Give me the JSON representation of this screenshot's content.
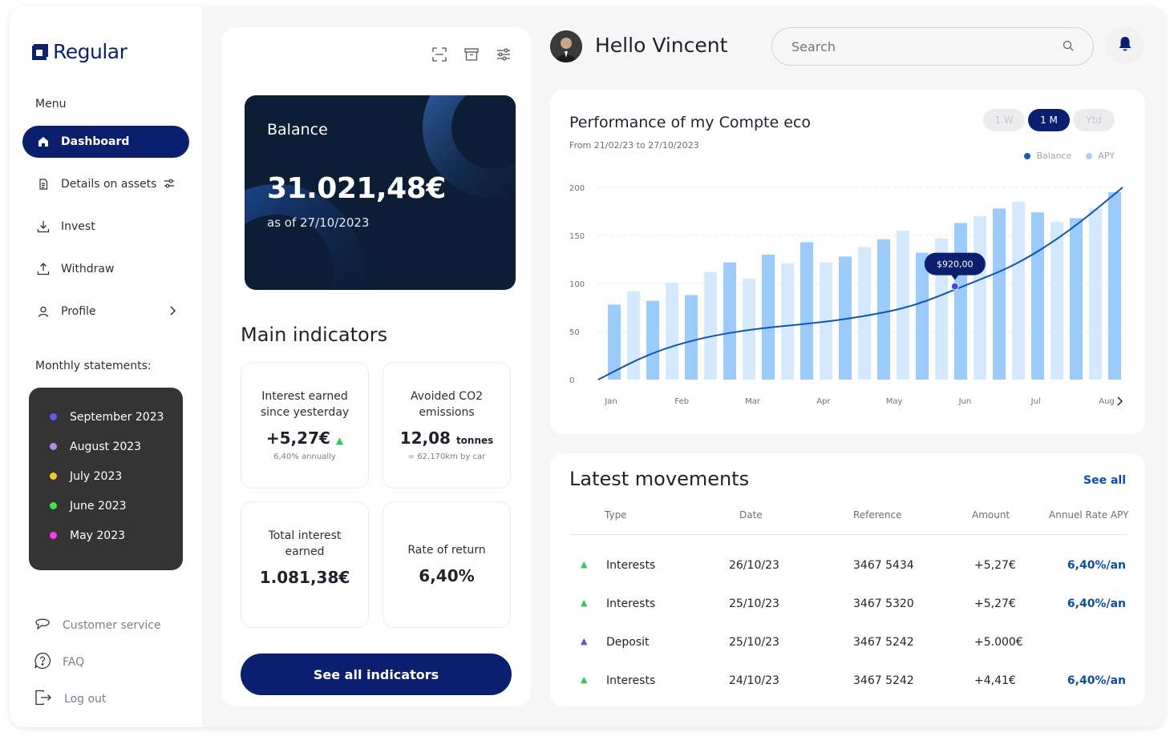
{
  "brand": {
    "name": "Regular",
    "color": "#0b2270"
  },
  "sidebar": {
    "menu_title": "Menu",
    "items": [
      {
        "label": "Dashboard",
        "icon": "home-icon",
        "active": true
      },
      {
        "label": "Details on assets",
        "icon": "document-icon",
        "trail_icon": "sliders-icon"
      },
      {
        "label": "Invest",
        "icon": "download-icon"
      },
      {
        "label": "Withdraw",
        "icon": "upload-icon"
      },
      {
        "label": "Profile",
        "icon": "user-icon",
        "trail_icon": "chevron-right-icon"
      }
    ],
    "statements_title": "Monthly statements:",
    "statements": [
      {
        "label": "September 2023",
        "color": "#5c5cf0"
      },
      {
        "label": "August 2023",
        "color": "#b388f5"
      },
      {
        "label": "July 2023",
        "color": "#f6c62b"
      },
      {
        "label": "June 2023",
        "color": "#3fe34b"
      },
      {
        "label": "May 2023",
        "color": "#f23ef0"
      }
    ],
    "bottom": [
      {
        "label": "Customer service",
        "icon": "chat-icon"
      },
      {
        "label": "FAQ",
        "icon": "help-icon"
      },
      {
        "label": "Log out",
        "icon": "logout-icon"
      }
    ]
  },
  "balance": {
    "title": "Balance",
    "amount": "31.021,48€",
    "date": "as of 27/10/2023"
  },
  "indicators": {
    "title": "Main indicators",
    "cards": [
      {
        "label_line1": "Interest earned",
        "label_line2": "since yesterday",
        "value": "+5,27€",
        "sub": "6,40% annually"
      },
      {
        "label_line1": "Avoided CO2",
        "label_line2": "emissions",
        "value": "12,08",
        "unit": "tonnes",
        "sub": "= 62,170km by car"
      },
      {
        "label_line1": "Total interest",
        "label_line2": "earned",
        "value": "1.081,38€"
      },
      {
        "label_line1": "Rate of return",
        "value": "6,40%"
      }
    ],
    "cta": "See all indicators"
  },
  "header": {
    "greeting": "Hello Vincent",
    "search_placeholder": "Search"
  },
  "performance": {
    "title": "Performance of my Compte eco",
    "subtitle": "From 21/02/23 to 27/10/2023",
    "ranges": [
      "1 W",
      "1 M",
      "Ytd"
    ],
    "active_range": "1 M",
    "legend": [
      {
        "label": "Balance",
        "color": "#0b5fc5"
      },
      {
        "label": "APY",
        "color": "#a8d0ff"
      }
    ],
    "tooltip": "$920,00"
  },
  "chart_data": {
    "type": "bar",
    "title": "Performance of my Compte eco",
    "yticks": [
      0,
      50,
      100,
      150,
      200
    ],
    "ylim": [
      0,
      200
    ],
    "xticks": [
      "Jan",
      "Feb",
      "Mar",
      "Apr",
      "May",
      "Jun",
      "Jul",
      "Aug"
    ],
    "grid": true,
    "legend_position": "top-right",
    "series": [
      {
        "name": "APY",
        "type": "bar",
        "values": [
          78,
          92,
          82,
          101,
          88,
          112,
          122,
          105,
          130,
          121,
          143,
          122,
          128,
          138,
          146,
          155,
          132,
          147,
          163,
          170,
          178,
          185,
          174,
          164,
          168,
          178,
          195
        ]
      },
      {
        "name": "Balance",
        "type": "line",
        "x": [
          0,
          0.1,
          0.2,
          0.3,
          0.4,
          0.5,
          0.6,
          0.7,
          0.8,
          0.9,
          1.0
        ],
        "values": [
          0,
          28,
          44,
          53,
          58,
          65,
          76,
          98,
          120,
          155,
          200
        ]
      }
    ],
    "highlight": {
      "label": "$920,00",
      "value": 97
    }
  },
  "movements": {
    "title": "Latest movements",
    "see_all": "See all",
    "columns": [
      "Type",
      "Date",
      "Reference",
      "Amount",
      "Annuel Rate APY"
    ],
    "rows": [
      {
        "type": "Interests",
        "arrow_color": "#3cc45a",
        "date": "26/10/23",
        "reference": "3467 5434",
        "amount": "+5,27€",
        "rate": "6,40%/an"
      },
      {
        "type": "Interests",
        "arrow_color": "#3cc45a",
        "date": "25/10/23",
        "reference": "3467 5320",
        "amount": "+5,27€",
        "rate": "6,40%/an"
      },
      {
        "type": "Deposit",
        "arrow_color": "#6b4ed6",
        "date": "25/10/23",
        "reference": "3467 5242",
        "amount": "+5.000€",
        "rate": ""
      },
      {
        "type": "Interests",
        "arrow_color": "#3cc45a",
        "date": "24/10/23",
        "reference": "3467 5242",
        "amount": "+4,41€",
        "rate": "6,40%/an"
      }
    ]
  }
}
